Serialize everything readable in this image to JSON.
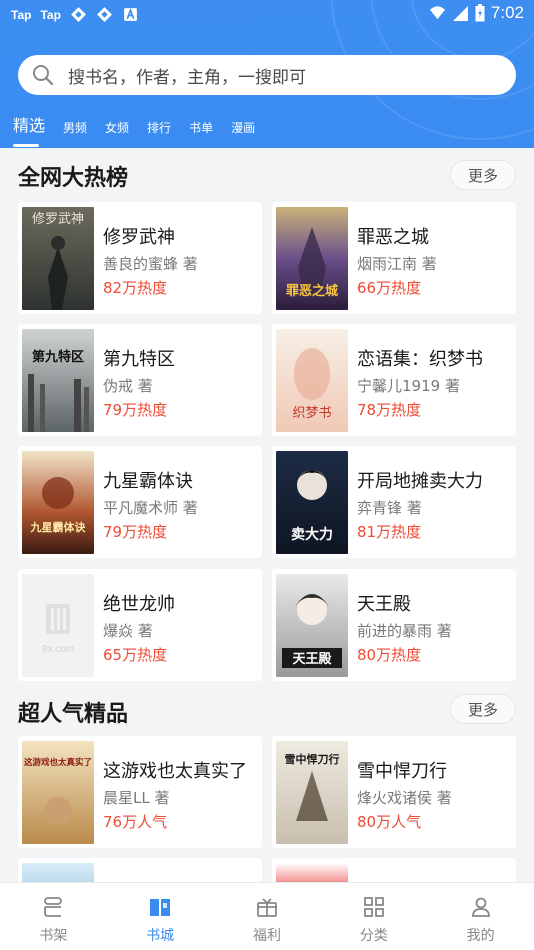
{
  "status_bar": {
    "app_icons": [
      "Tap",
      "Tap"
    ],
    "time": "7:02",
    "icon_names": [
      "taptap-icon",
      "taptap-icon",
      "vpn-icon",
      "vpn-icon",
      "a-icon",
      "wifi-icon",
      "signal-icon",
      "battery-icon"
    ]
  },
  "search": {
    "placeholder": "搜书名，作者，主角，一搜即可"
  },
  "tabs": [
    {
      "label": "精选",
      "active": true
    },
    {
      "label": "男频"
    },
    {
      "label": "女频"
    },
    {
      "label": "排行"
    },
    {
      "label": "书单"
    },
    {
      "label": "漫画"
    }
  ],
  "sections": [
    {
      "title": "全网大热榜",
      "more_label": "更多",
      "books": [
        {
          "title": "修罗武神",
          "author": "善良的蜜蜂 著",
          "heat": "82万热度"
        },
        {
          "title": "罪恶之城",
          "author": "烟雨江南 著",
          "heat": "66万热度"
        },
        {
          "title": "第九特区",
          "author": "伪戒 著",
          "heat": "79万热度"
        },
        {
          "title": "恋语集：织梦书",
          "author": "宁馨儿1919 著",
          "heat": "78万热度"
        },
        {
          "title": "九星霸体诀",
          "author": "平凡魔术师 著",
          "heat": "79万热度"
        },
        {
          "title": "开局地摊卖大力",
          "author": "弈青锋 著",
          "heat": "81万热度"
        },
        {
          "title": "绝世龙帅",
          "author": "爆焱 著",
          "heat": "65万热度"
        },
        {
          "title": "天王殿",
          "author": "前进的暴雨 著",
          "heat": "80万热度"
        }
      ]
    },
    {
      "title": "超人气精品",
      "more_label": "更多",
      "books": [
        {
          "title": "这游戏也太真实了",
          "author": "晨星LL 著",
          "heat": "76万人气"
        },
        {
          "title": "雪中悍刀行",
          "author": "烽火戏诸侯 著",
          "heat": "80万人气"
        }
      ]
    }
  ],
  "cover_texts": {
    "b0": "修罗武神",
    "b1": "罪恶之城",
    "b2": "第九特区",
    "b3": "织梦书",
    "b4": "九星霸体诀",
    "b5": "卖大力",
    "b6": "9x.com",
    "b7": "天王殿",
    "b8": "这游戏也太真实了",
    "b9": "雪中悍刀行"
  },
  "bottom_nav": [
    {
      "label": "书架",
      "icon": "bookshelf-icon"
    },
    {
      "label": "书城",
      "icon": "bookstore-icon",
      "active": true
    },
    {
      "label": "福利",
      "icon": "gift-icon"
    },
    {
      "label": "分类",
      "icon": "category-grid-icon"
    },
    {
      "label": "我的",
      "icon": "profile-icon"
    }
  ],
  "colors": {
    "accent": "#3a8cf2",
    "heat": "#ef4b35"
  }
}
